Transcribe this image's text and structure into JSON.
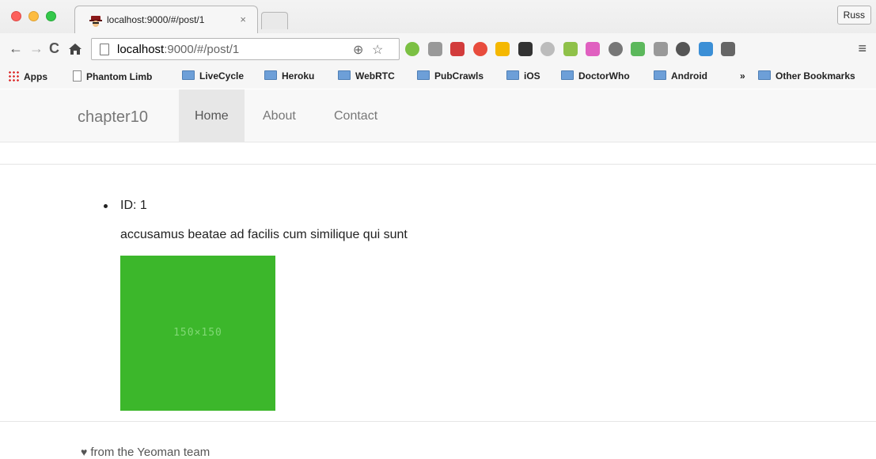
{
  "browser": {
    "tab_title": "localhost:9000/#/post/1",
    "tab_close": "×",
    "profile_name": "Russ",
    "url_host": "localhost",
    "url_path": ":9000/#/post/1",
    "nav_icons": [
      "back-icon",
      "forward-icon",
      "reload-icon",
      "home-icon"
    ],
    "extension_colors": [
      "#7bc043",
      "#999999",
      "#d23c3c",
      "#e84c3d",
      "#f5b800",
      "#333333",
      "#bcbcbc",
      "#8fc149",
      "#e060c0",
      "#777777",
      "#5cb85c",
      "#999999",
      "#555555",
      "#3b8fd6",
      "#666666"
    ],
    "menu_icon": "≡"
  },
  "bookmarks": [
    {
      "label": "Apps",
      "icon": "apps-icon"
    },
    {
      "label": "Phantom Limb",
      "icon": "page-icon"
    },
    {
      "label": "LiveCycle",
      "icon": "folder-icon"
    },
    {
      "label": "Heroku",
      "icon": "folder-icon"
    },
    {
      "label": "WebRTC",
      "icon": "folder-icon"
    },
    {
      "label": "PubCrawls",
      "icon": "folder-icon"
    },
    {
      "label": "iOS",
      "icon": "folder-icon"
    },
    {
      "label": "DoctorWho",
      "icon": "folder-icon"
    },
    {
      "label": "Android",
      "icon": "folder-icon"
    },
    {
      "label": "»",
      "icon": ""
    },
    {
      "label": "Other Bookmarks",
      "icon": "folder-icon"
    }
  ],
  "navbar": {
    "brand": "chapter10",
    "links": [
      "Home",
      "About",
      "Contact"
    ],
    "active": "Home"
  },
  "post": {
    "id_text": "ID: 1",
    "title": "accusamus beatae ad facilis cum similique qui sunt",
    "image_label": "150×150",
    "image_color": "#3cb72b"
  },
  "footer": {
    "text": "from the Yeoman team",
    "icon": "heart-icon"
  }
}
